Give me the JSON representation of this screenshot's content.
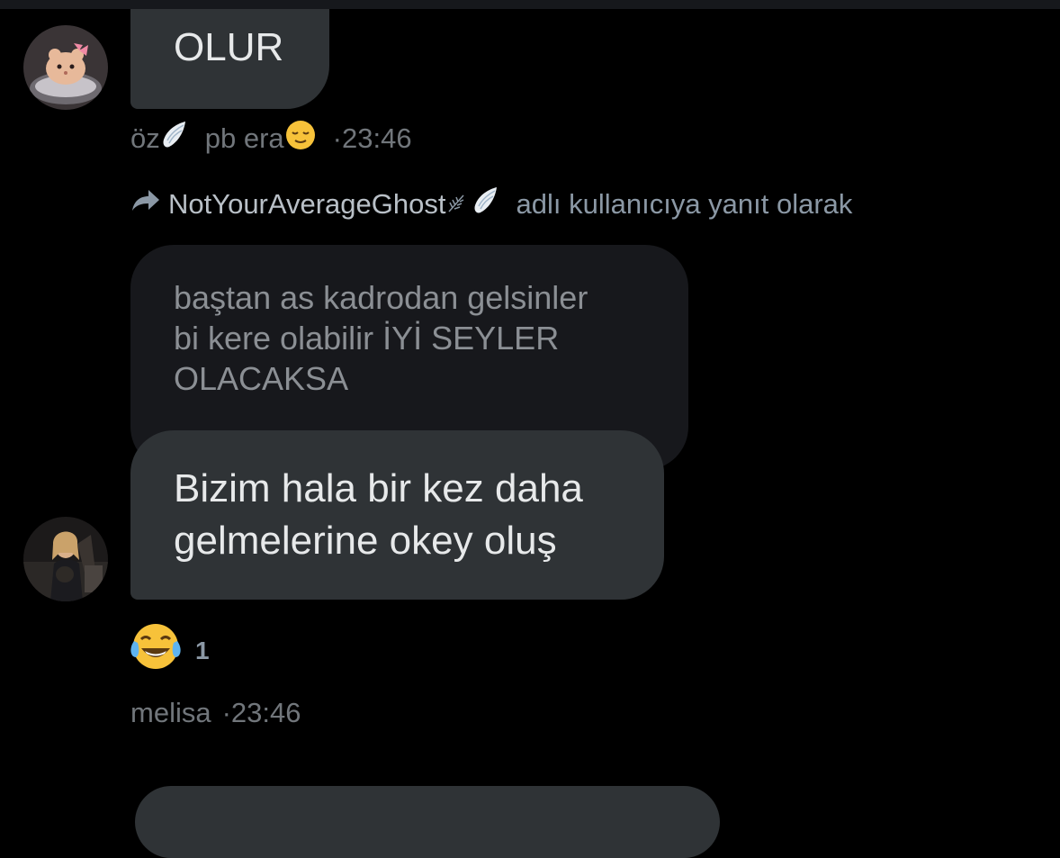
{
  "messages": [
    {
      "text": "OLUR",
      "sender_name": "öz",
      "sender_status": "pb era",
      "time": "·23:46"
    },
    {
      "reply_to_handle": "NotYourAverageGhost",
      "reply_suffix": "adlı kullanıcıya yanıt olarak",
      "quoted_lines": [
        "baştan as kadrodan gelsinler",
        "bi kere olabilir İYİ SEYLER",
        "OLACAKSA"
      ],
      "text_lines": [
        "Bizim hala bir kez daha",
        "gelmelerine okey oluş"
      ],
      "reaction": {
        "emoji": "😂",
        "count": "1"
      },
      "sender_name": "melisa",
      "time": "·23:46"
    }
  ],
  "icons": {
    "wing": "angel-wing-icon",
    "relieved": "relieved-face-icon",
    "reply": "reply-arrow-icon",
    "leaf": "leaf-icon",
    "joy": "tears-of-joy-icon"
  },
  "colors": {
    "background": "#000000",
    "bubble": "#2f3336",
    "quoted_bubble": "#17181c",
    "meta_text": "#71767b"
  }
}
